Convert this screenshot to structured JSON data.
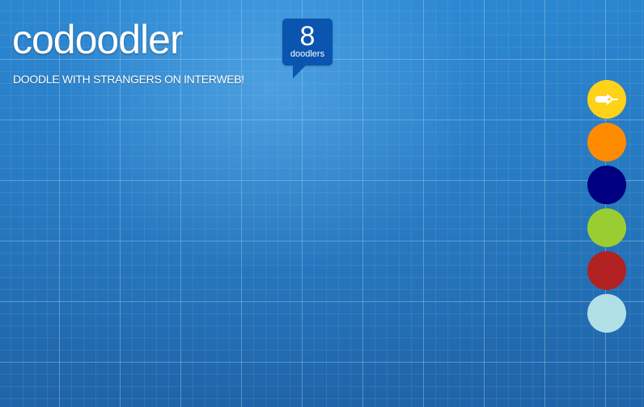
{
  "header": {
    "title": "codoodler",
    "tagline": "DOODLE WITH STRANGERS ON INTERWEB!"
  },
  "counter": {
    "value": "8",
    "label": "doodlers",
    "color": "#0a55b0"
  },
  "palette": {
    "tool": {
      "icon": "pen-icon",
      "color": "#ffd21a",
      "selected": true
    },
    "colors": [
      {
        "name": "orange",
        "hex": "#ff8c00"
      },
      {
        "name": "navy",
        "hex": "#000080"
      },
      {
        "name": "yellow-green",
        "hex": "#9acd32"
      },
      {
        "name": "firebrick",
        "hex": "#b22222"
      },
      {
        "name": "light-blue",
        "hex": "#b0e0e6"
      }
    ]
  },
  "theme": {
    "background": "#2a7ec4",
    "text": "#ffffff"
  }
}
